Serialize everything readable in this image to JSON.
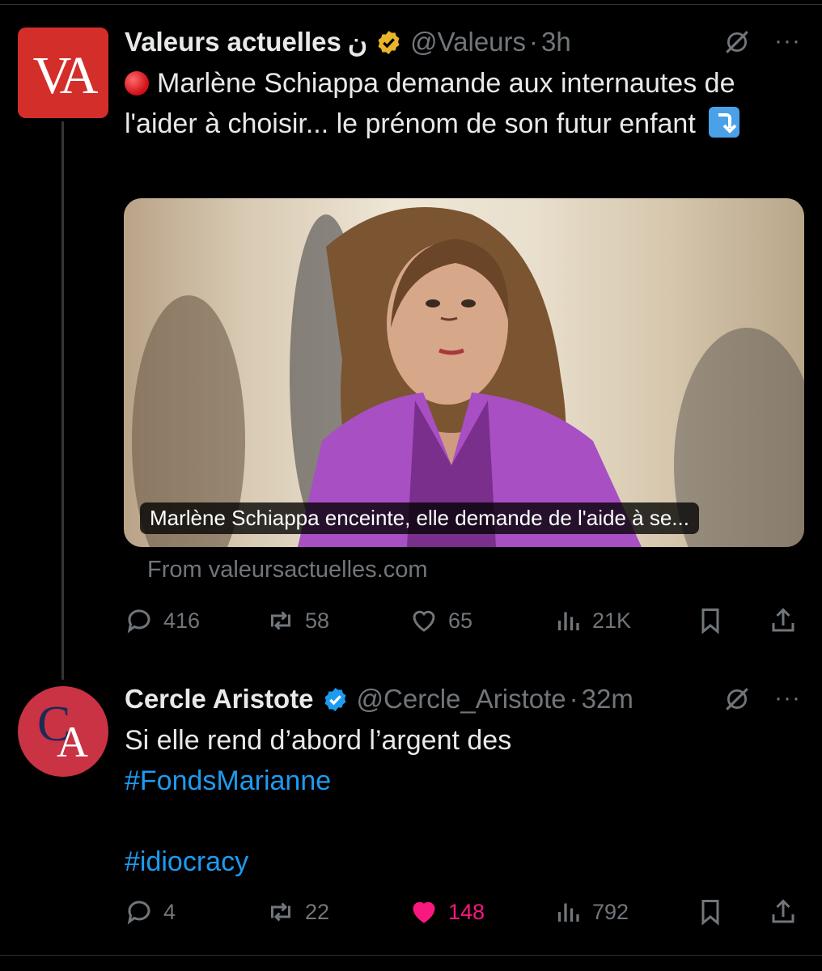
{
  "tweets": [
    {
      "author_name": "Valeurs actuelles",
      "name_glyph": "ن",
      "handle": "@Valeurs",
      "separator": "·",
      "time": "3h",
      "avatar_text": "VA",
      "text": "Marlène Schiappa demande aux internautes de l'aider à choisir... le prénom de son futur enfant",
      "card": {
        "title": "Marlène Schiappa enceinte, elle demande de l'aide à se...",
        "source": "From valeursactuelles.com"
      },
      "stats": {
        "replies": "416",
        "reposts": "58",
        "likes": "65",
        "views": "21K"
      }
    },
    {
      "author_name": "Cercle Aristote",
      "handle": "@Cercle_Aristote",
      "separator": "·",
      "time": "32m",
      "avatar_c": "C",
      "avatar_a": "A",
      "text_line": "Si elle rend d’abord l’argent des",
      "hashtag1": "#FondsMarianne",
      "hashtag2": "#idiocracy",
      "stats": {
        "replies": "4",
        "reposts": "22",
        "likes": "148",
        "views": "792"
      }
    }
  ],
  "more_label": "···",
  "colors": {
    "background": "#000000",
    "text": "#e7e9ea",
    "muted": "#71767b",
    "link": "#1d9bf0",
    "like": "#f91880",
    "gold_badge": "#e9b42a",
    "blue_badge": "#1d9bf0"
  },
  "icons": [
    "reply-icon",
    "repost-icon",
    "like-icon",
    "views-icon",
    "bookmark-icon",
    "share-icon",
    "grok-icon",
    "verified-badge-icon",
    "red-circle-emoji",
    "arrow-down-emoji"
  ]
}
